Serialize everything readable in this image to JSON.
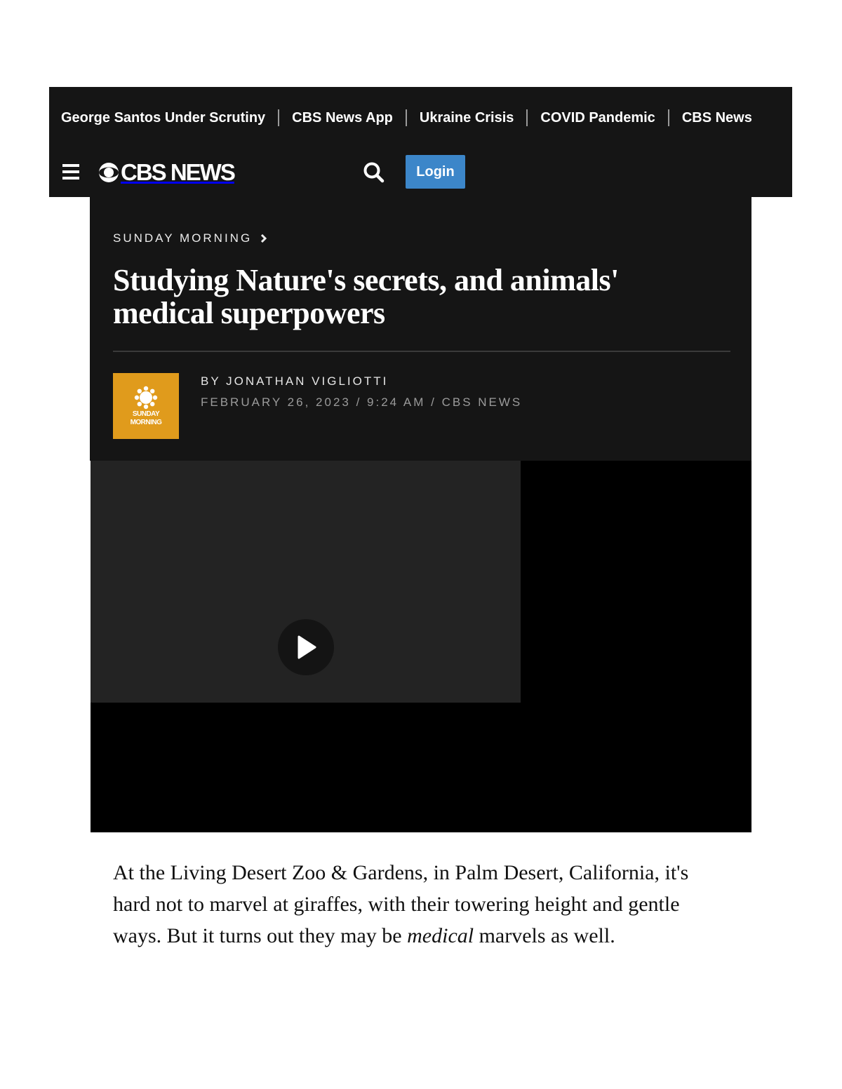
{
  "trending": [
    {
      "label": "George Santos Under Scrutiny"
    },
    {
      "label": "CBS News App"
    },
    {
      "label": "Ukraine Crisis"
    },
    {
      "label": "COVID Pandemic"
    },
    {
      "label": "CBS News"
    }
  ],
  "nav": {
    "menu_icon": "hamburger-menu-icon",
    "logo_text": "CBS NEWS",
    "search_icon": "search-icon",
    "login_label": "Login",
    "login_color": "#3c86c9"
  },
  "article": {
    "section": "SUNDAY MORNING",
    "title": "Studying Nature's secrets, and animals' medical superpowers",
    "badge_line1": "SUNDAY",
    "badge_line2": "MORNING",
    "badge_color": "#e09b1c",
    "byline_prefix": "BY",
    "author": "JONATHAN VIGLIOTTI",
    "date": "FEBRUARY 26, 2023",
    "time": "9:24 AM",
    "source": "CBS NEWS",
    "video_play_icon": "play-icon",
    "body_part1": "At the Living Desert Zoo & Gardens, in Palm Desert, California, it's hard not to marvel at giraffes, with their towering height and gentle ways. But it turns out they may be ",
    "body_emphasis": "medical",
    "body_part2": " marvels as well."
  }
}
